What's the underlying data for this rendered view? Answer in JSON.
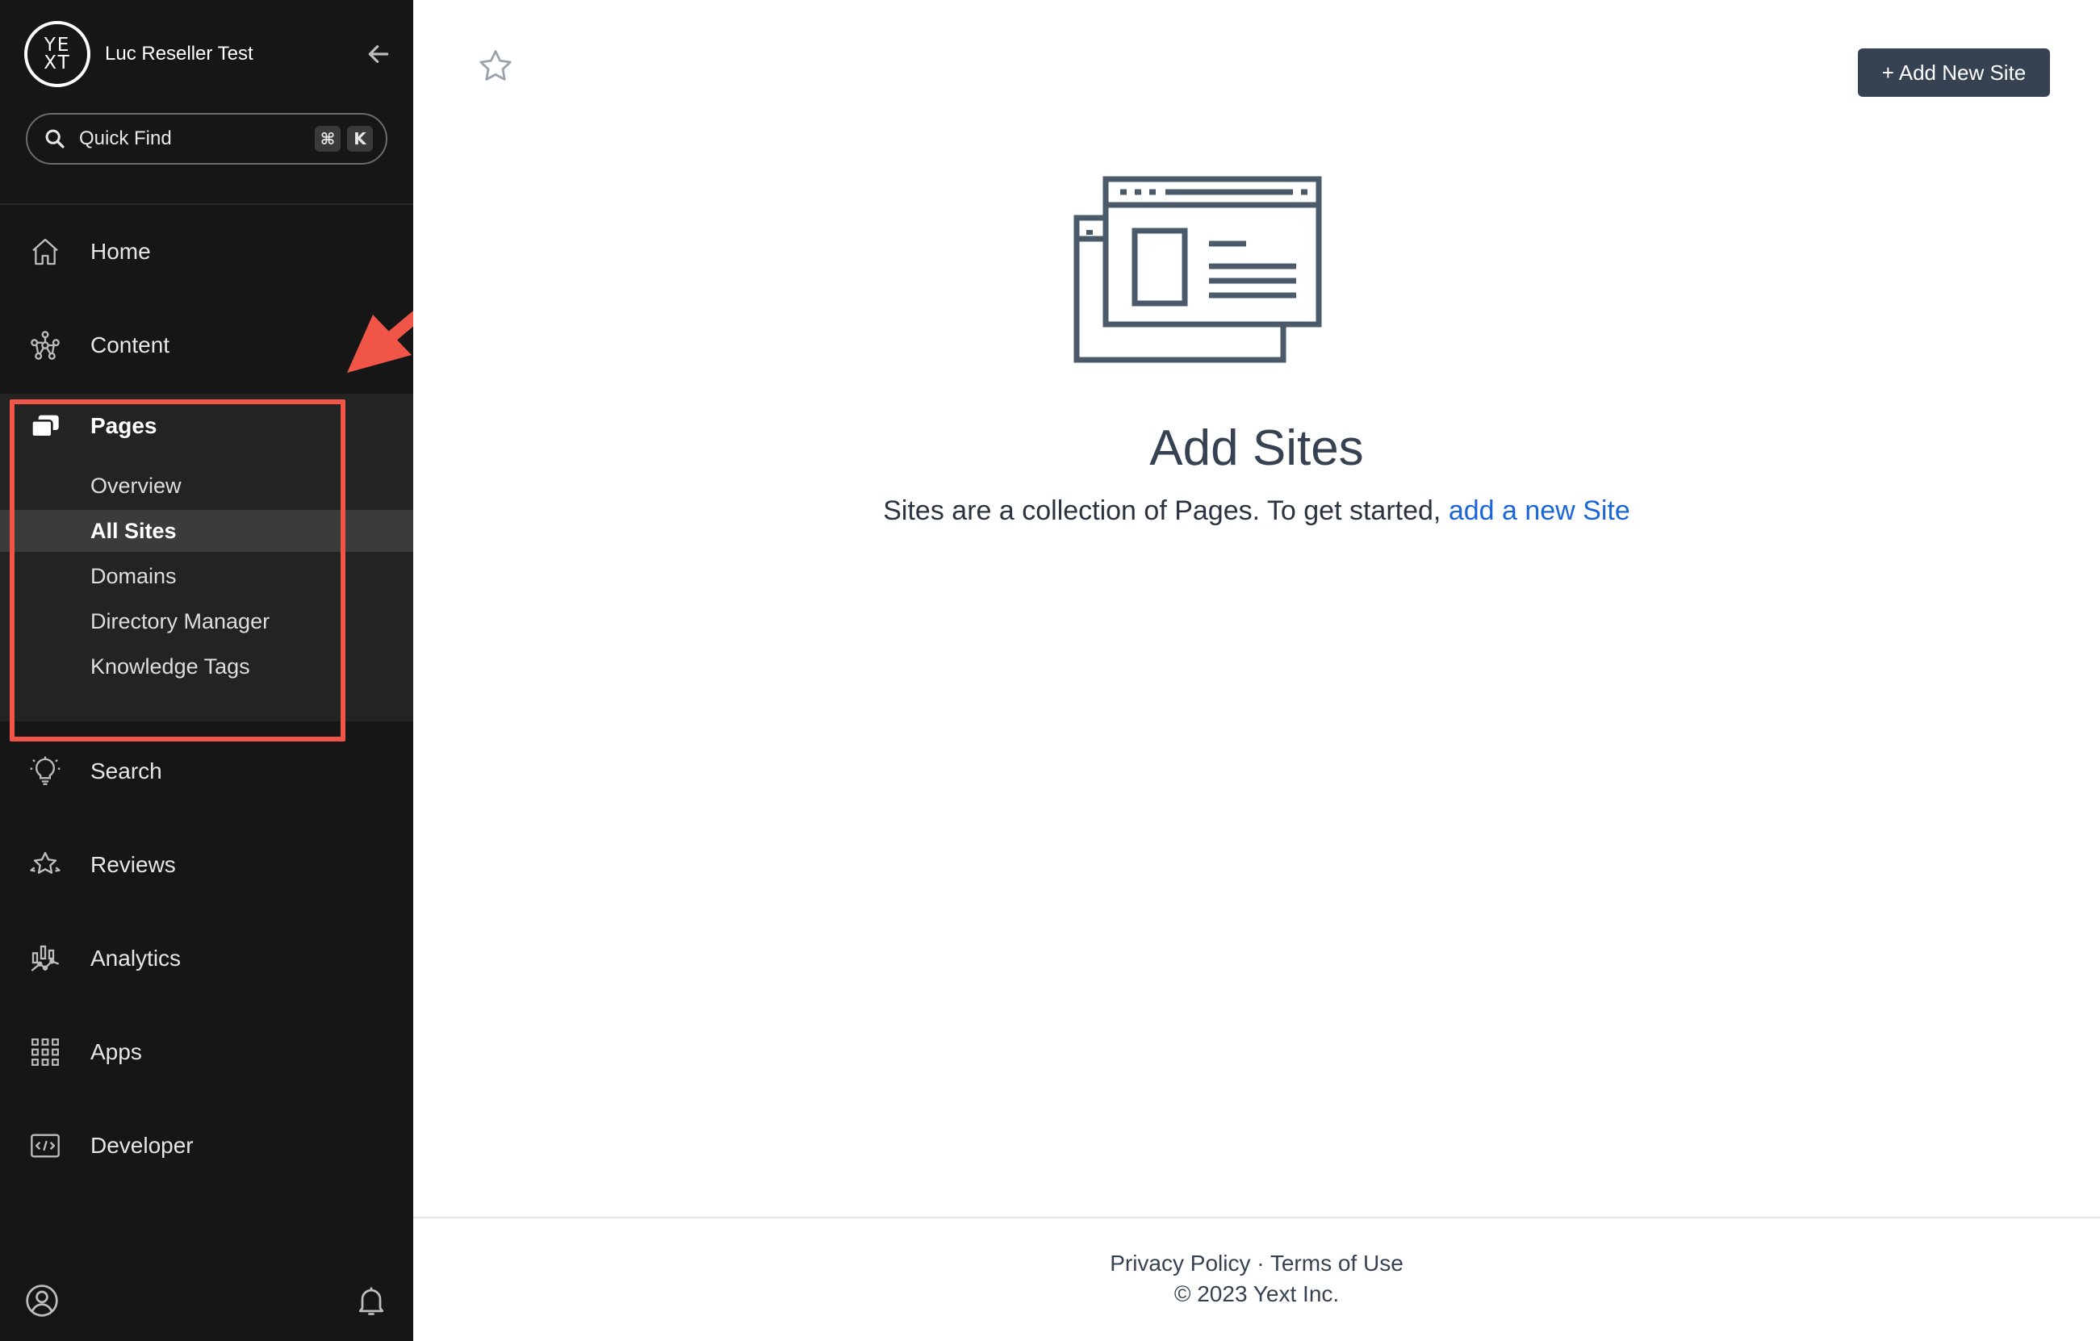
{
  "account": {
    "logo_text": "YE\nXT",
    "name": "Luc Reseller Test"
  },
  "quick_find": {
    "label": "Quick Find",
    "shortcut_keys": [
      "⌘",
      "K"
    ]
  },
  "nav": {
    "home": "Home",
    "content": "Content",
    "pages": "Pages",
    "search": "Search",
    "reviews": "Reviews",
    "analytics": "Analytics",
    "apps": "Apps",
    "developer": "Developer"
  },
  "pages_submenu": {
    "items": [
      {
        "label": "Overview",
        "active": false
      },
      {
        "label": "All Sites",
        "active": true
      },
      {
        "label": "Domains",
        "active": false
      },
      {
        "label": "Directory Manager",
        "active": false
      },
      {
        "label": "Knowledge Tags",
        "active": false
      }
    ]
  },
  "header": {
    "add_button_label": "+ Add New Site"
  },
  "empty_state": {
    "title": "Add Sites",
    "text_prefix": "Sites are a collection of Pages. To get started, ",
    "link_text": "add a new Site"
  },
  "footer": {
    "privacy": "Privacy Policy",
    "separator": " · ",
    "terms": "Terms of Use",
    "copyright": "© 2023 Yext Inc."
  },
  "colors": {
    "sidebar_bg": "#161616",
    "sidebar_section_bg": "#232323",
    "active_item_bg": "#3b3b3b",
    "annotation_red": "#f05548",
    "primary_button": "#364152",
    "link_blue": "#1a66d9"
  }
}
